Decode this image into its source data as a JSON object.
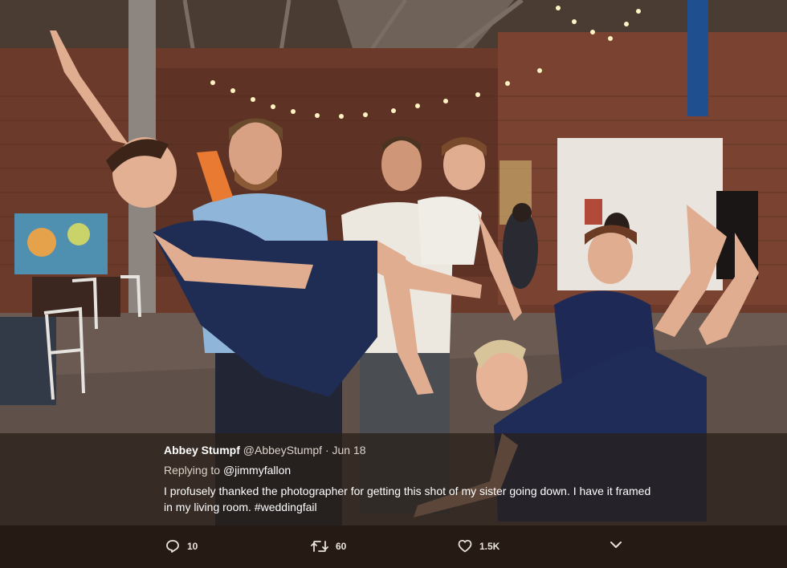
{
  "tweet": {
    "display_name": "Abbey Stumpf",
    "handle": "@AbbeyStumpf",
    "separator": "·",
    "date": "Jun 18",
    "replying_prefix": "Replying to",
    "replying_to": "@jimmyfallon",
    "text": "I profusely thanked the photographer for getting this shot of my sister going down. I have it framed in my living room.",
    "hashtag": "#weddingfail"
  },
  "actions": {
    "reply_icon": "reply-icon",
    "reply_count": "10",
    "retweet_icon": "retweet-icon",
    "retweet_count": "60",
    "like_icon": "heart-icon",
    "like_count": "1.5K",
    "more_icon": "chevron-down-icon"
  },
  "colors": {
    "overlay": "#281e18",
    "action_bar": "#251b14",
    "text": "#ffffff"
  }
}
